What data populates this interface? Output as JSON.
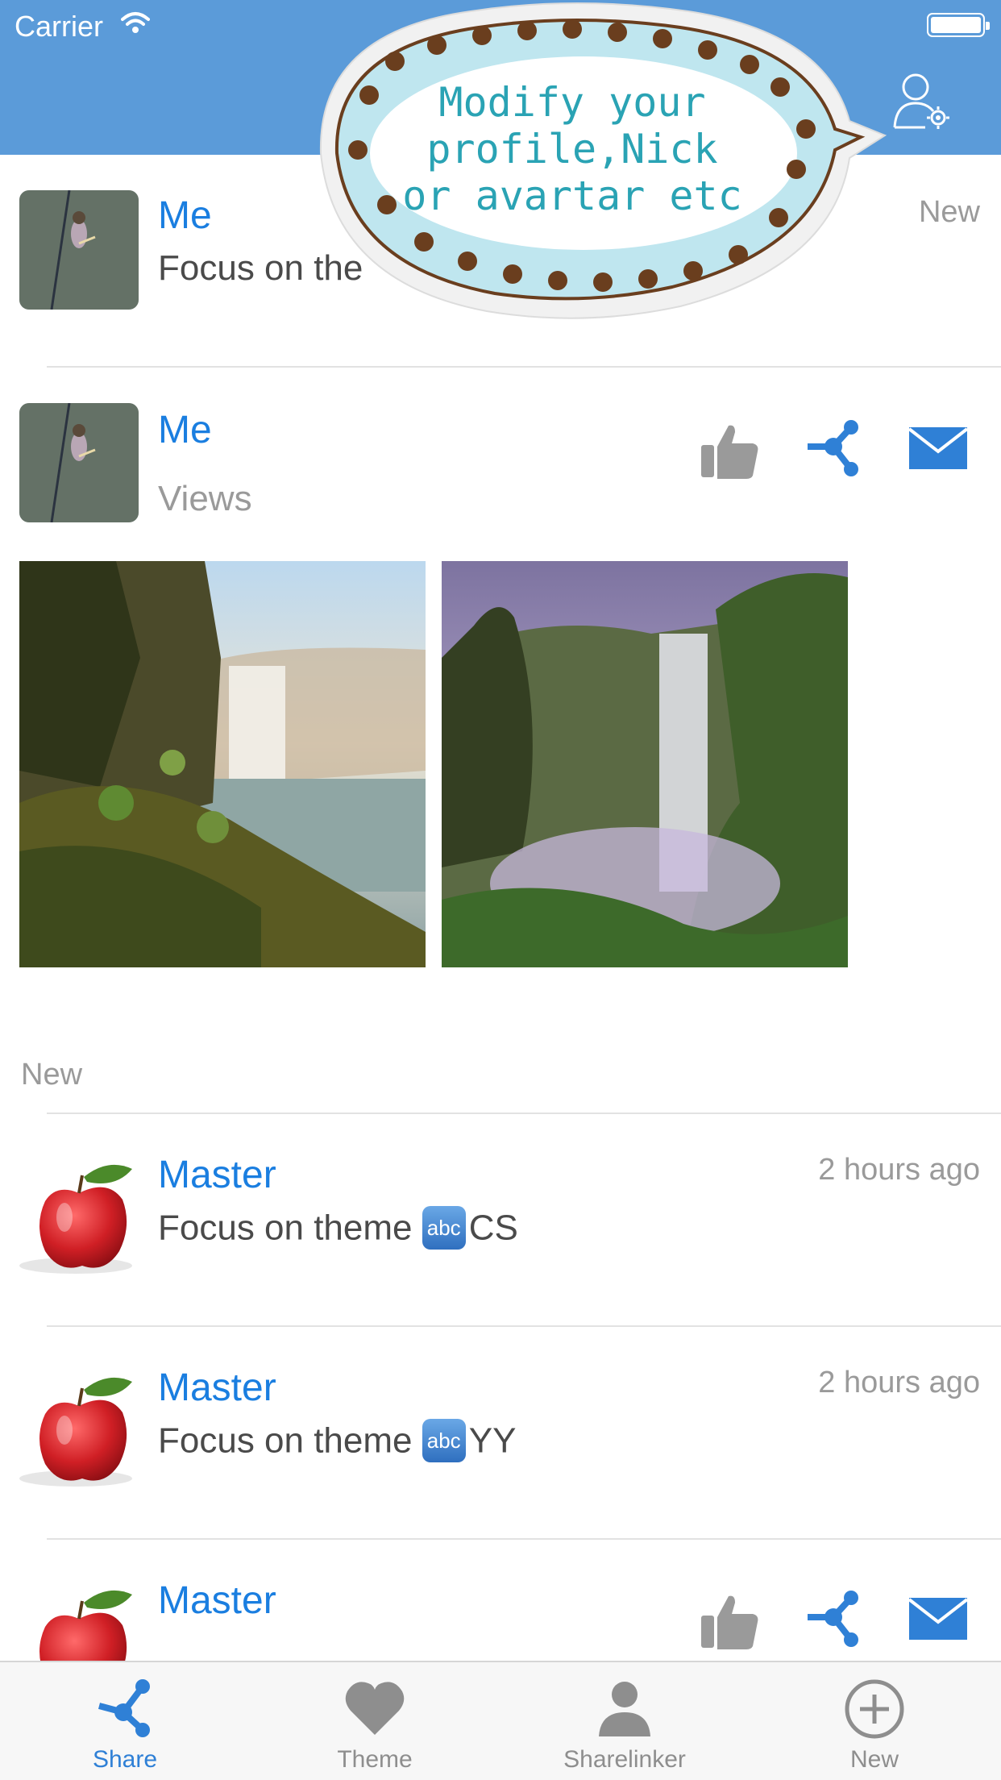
{
  "status_bar": {
    "carrier": "Carrier"
  },
  "tooltip": {
    "lines": [
      "Modify your",
      "profile,Nick",
      "or avartar etc"
    ]
  },
  "feed": {
    "top_post": {
      "name": "Me",
      "text": "Focus on the",
      "badge": "New"
    },
    "photo_post": {
      "name": "Me",
      "text": "Views"
    },
    "section_label": "New",
    "items": [
      {
        "name": "Master",
        "prefix": "Focus on theme",
        "badge": "abc",
        "suffix": "CS",
        "time": "2 hours ago"
      },
      {
        "name": "Master",
        "prefix": "Focus on theme",
        "badge": "abc",
        "suffix": "YY",
        "time": "2 hours ago"
      },
      {
        "name": "Master"
      }
    ]
  },
  "tabs": [
    {
      "label": "Share",
      "icon": "share-icon",
      "active": true
    },
    {
      "label": "Theme",
      "icon": "heart-icon",
      "active": false
    },
    {
      "label": "Sharelinker",
      "icon": "person-icon",
      "active": false
    },
    {
      "label": "New",
      "icon": "plus-circle-icon",
      "active": false
    }
  ],
  "colors": {
    "header": "#5b9bd9",
    "accent": "#1a7ee0",
    "tooltip_text": "#2aa3b4",
    "muted": "#9a9a9a"
  }
}
